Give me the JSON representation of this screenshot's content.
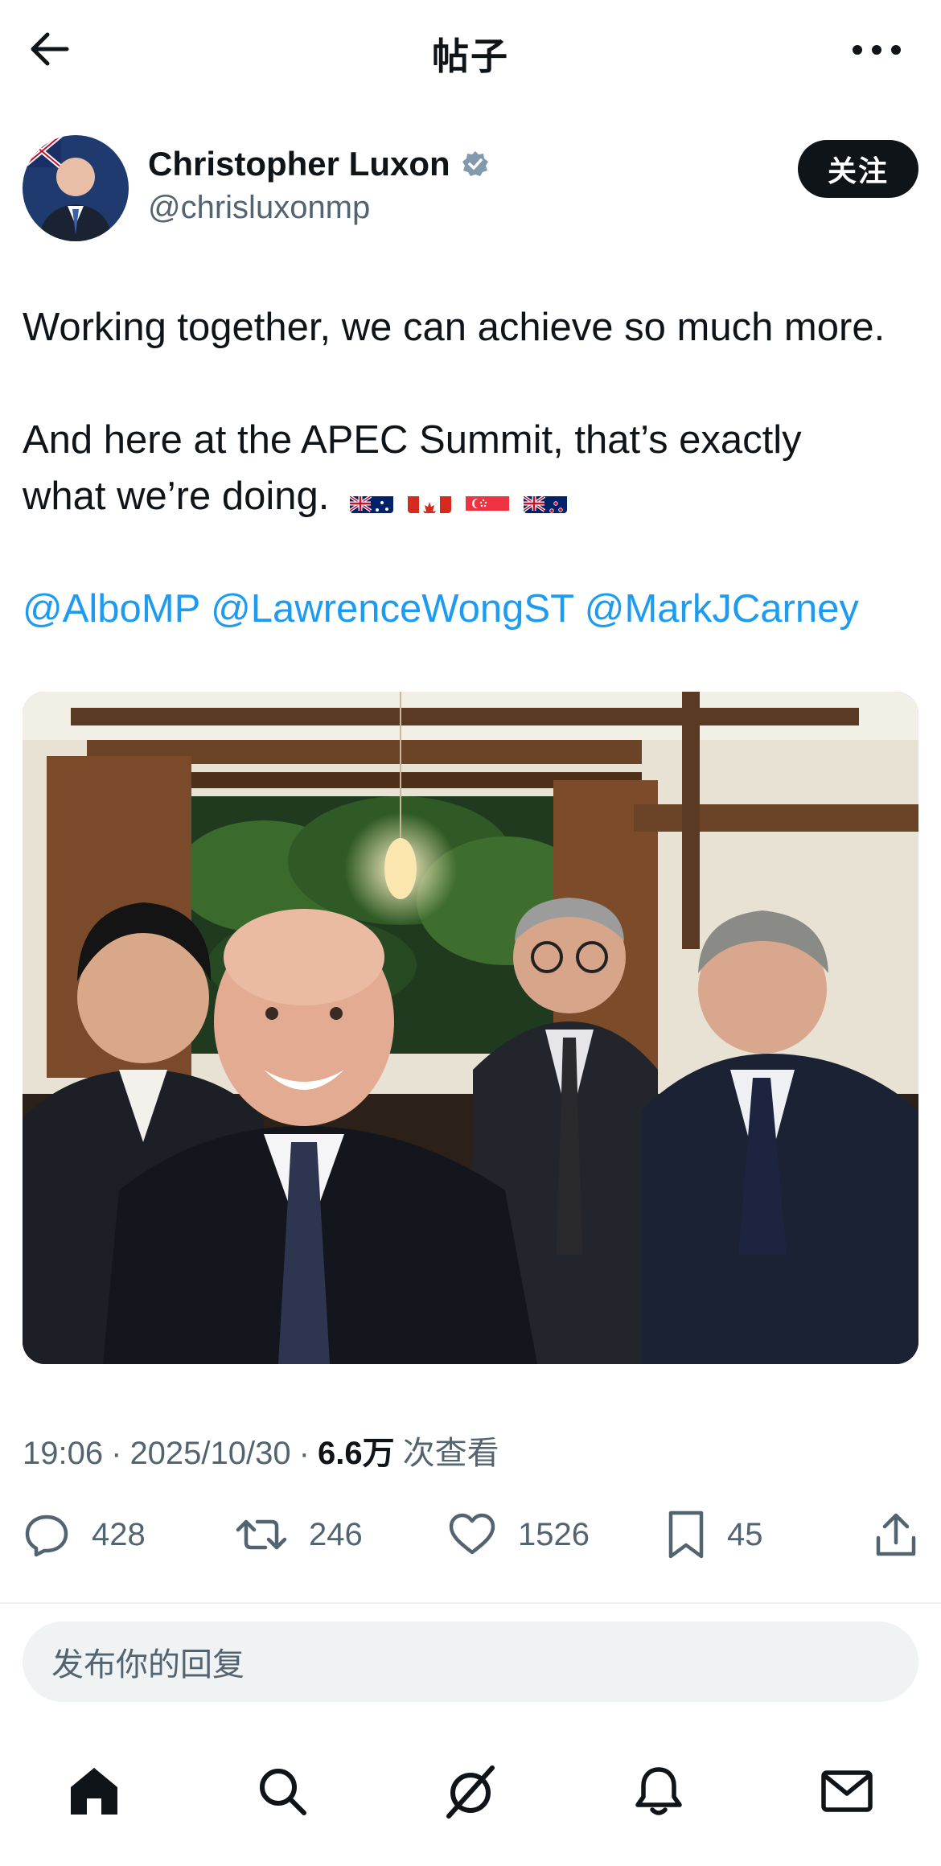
{
  "header": {
    "title": "帖子"
  },
  "author": {
    "name": "Christopher Luxon",
    "handle": "@chrisluxonmp",
    "verified": true,
    "follow_label": "关注"
  },
  "post": {
    "line1": "Working together, we can achieve so much more.",
    "line2": "And here at the APEC Summit, that’s exactly",
    "line3": "what we’re doing.",
    "flags": [
      "Australia",
      "Canada",
      "Singapore",
      "New Zealand"
    ],
    "mentions": [
      "@AlboMP",
      "@LawrenceWongST",
      "@MarkJCarney"
    ]
  },
  "meta": {
    "time": "19:06",
    "sep1": "·",
    "date": "2025/10/30",
    "sep2": "·",
    "views": "6.6万",
    "views_suffix": "次查看"
  },
  "actions": {
    "reply_count": "428",
    "repost_count": "246",
    "like_count": "1526",
    "bookmark_count": "45"
  },
  "reply": {
    "placeholder": "发布你的回复"
  },
  "nav": {
    "items": [
      "home-icon",
      "search-icon",
      "grok-icon",
      "notifications-icon",
      "messages-icon"
    ]
  },
  "colors": {
    "text": "#0f1419",
    "secondary": "#536471",
    "link": "#1d9bf0",
    "verified": "#829aab"
  }
}
